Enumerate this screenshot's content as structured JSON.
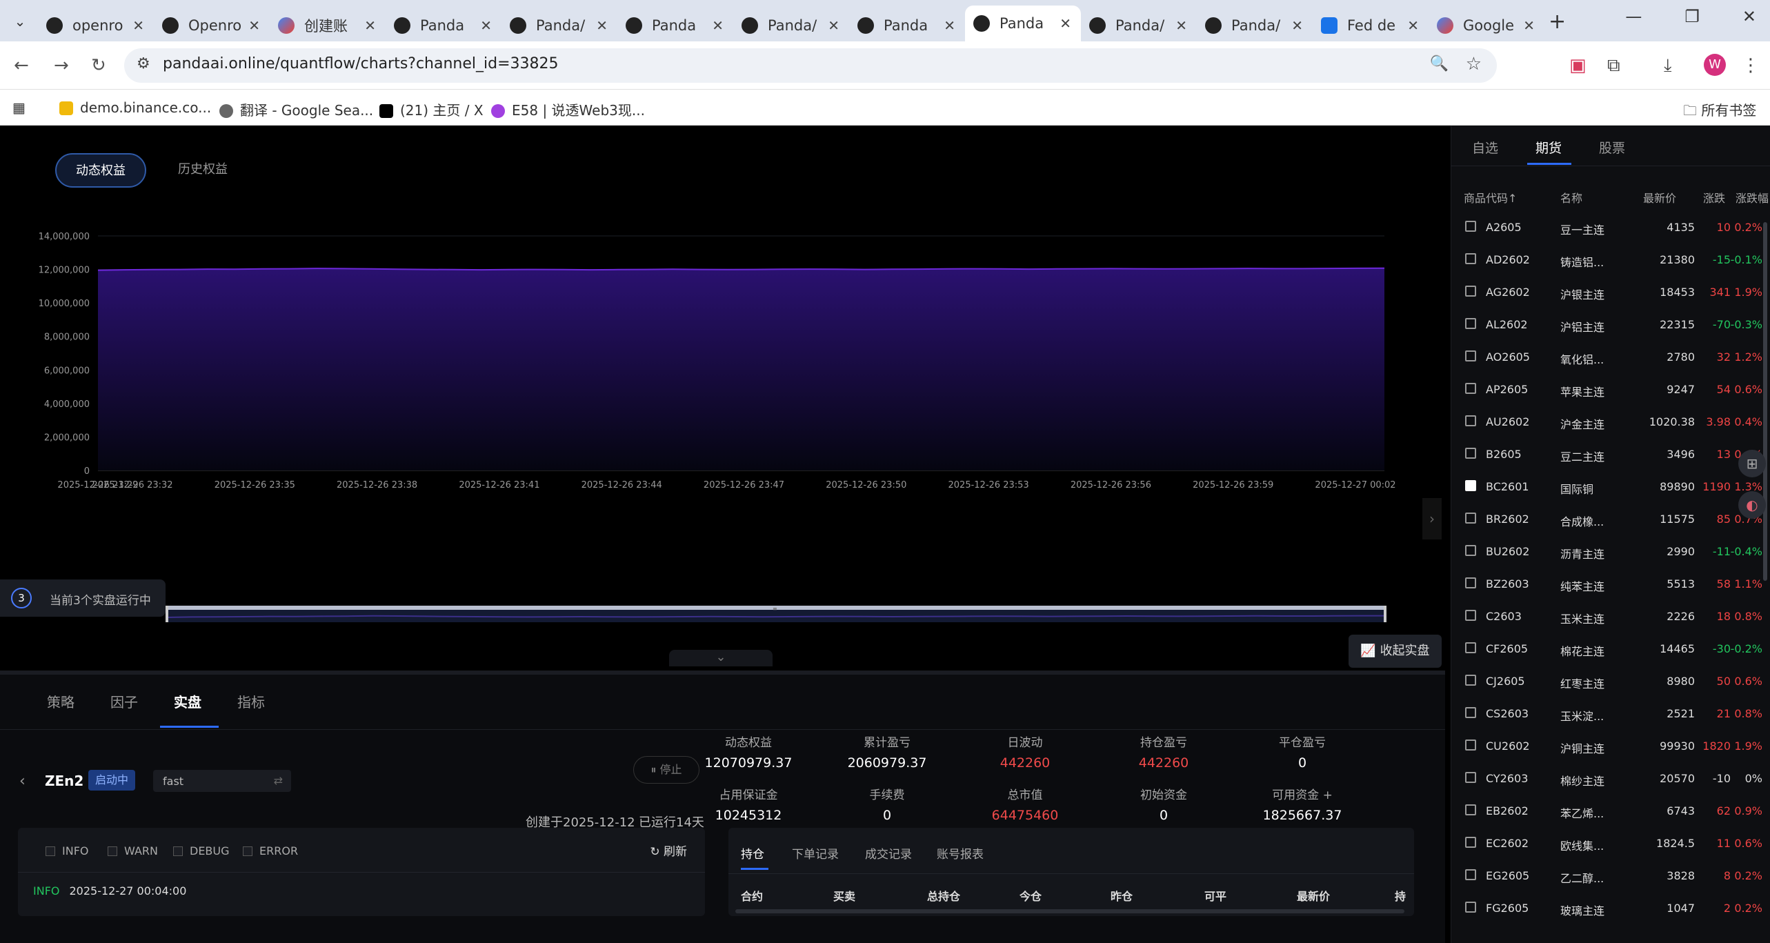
{
  "browser": {
    "tabs": [
      {
        "label": "openro",
        "icon": "openrouter-favicon"
      },
      {
        "label": "Openro",
        "icon": "openrouter-favicon"
      },
      {
        "label": "创建账",
        "icon": "gemini-favicon"
      },
      {
        "label": "Panda",
        "icon": "panda-favicon"
      },
      {
        "label": "Panda/",
        "icon": "panda-favicon"
      },
      {
        "label": "Panda",
        "icon": "panda-favicon"
      },
      {
        "label": "Panda/",
        "icon": "panda-favicon"
      },
      {
        "label": "Panda",
        "icon": "panda-favicon"
      },
      {
        "label": "Panda",
        "icon": "panda-favicon",
        "active": true
      },
      {
        "label": "Panda/",
        "icon": "panda-favicon"
      },
      {
        "label": "Panda/",
        "icon": "panda-favicon"
      },
      {
        "label": "Fed de",
        "icon": "fed-favicon"
      },
      {
        "label": "Google",
        "icon": "gemini-favicon"
      }
    ],
    "url": "pandaai.online/quantflow/charts?channel_id=33825",
    "bookmarks": [
      {
        "label": "demo.binance.co..."
      },
      {
        "label": "翻译 - Google Sea..."
      },
      {
        "label": "(21) 主页 / X"
      },
      {
        "label": "E58 | 说透Web3现..."
      }
    ],
    "all_bookmarks": "所有书签",
    "avatar_letter": "W"
  },
  "chart_view": {
    "toggle_dynamic": "动态权益",
    "toggle_history": "历史权益",
    "runner_badge": "3",
    "runner_text": "当前3个实盘运行中",
    "collapse_button": "收起实盘"
  },
  "chart_data": {
    "type": "area",
    "series": [
      {
        "name": "",
        "values": [
          11950000,
          11980000,
          11990000,
          12000000,
          12020000,
          12010000,
          12030000,
          12040000,
          12060000,
          12050000,
          12030000,
          12010000,
          12000000,
          11990000,
          11980000,
          11990000,
          12000000,
          11990000,
          11980000,
          11990000,
          12000000,
          12010000,
          12000000,
          11990000,
          12000000,
          12010000,
          12020000,
          12010000,
          12000000,
          12010000,
          12020000,
          12030000,
          12040000,
          12030000,
          12020000,
          12030000,
          12040000,
          12050000,
          12040000,
          12030000,
          12040000,
          12050000,
          12060000,
          12050000,
          12050000,
          12060000,
          12070000,
          12070979.37
        ]
      }
    ],
    "x_tick_labels": [
      "2025-12-26 23:29",
      "2025-12-26 23:32",
      "2025-12-26 23:35",
      "2025-12-26 23:38",
      "2025-12-26 23:41",
      "2025-12-26 23:44",
      "2025-12-26 23:47",
      "2025-12-26 23:50",
      "2025-12-26 23:53",
      "2025-12-26 23:56",
      "2025-12-26 23:59",
      "2025-12-27 00:02"
    ],
    "y_ticks": [
      "0",
      "2,000,000",
      "4,000,000",
      "6,000,000",
      "8,000,000",
      "10,000,000",
      "12,000,000",
      "14,000,000"
    ],
    "ylim": [
      0,
      14000000
    ],
    "grid": true,
    "colors": {
      "line": "#6d28d9",
      "area_top": "#2a1170",
      "area_bottom": "#050510"
    }
  },
  "bottom_tabs": [
    "策略",
    "因子",
    "实盘",
    "指标"
  ],
  "strategy": {
    "name": "ZEn2",
    "status": "启动中",
    "mode": "fast",
    "stop_label": "停止",
    "created": "创建于2025-12-12",
    "uptime": "已运行14天"
  },
  "metrics": [
    {
      "label": "动态权益",
      "value": "12070979.37",
      "red": false
    },
    {
      "label": "累计盈亏",
      "value": "2060979.37",
      "red": false
    },
    {
      "label": "日波动",
      "value": "442260",
      "red": true
    },
    {
      "label": "持仓盈亏",
      "value": "442260",
      "red": true
    },
    {
      "label": "平仓盈亏",
      "value": "0",
      "red": false
    },
    {
      "label": "占用保证金",
      "value": "10245312",
      "red": false
    },
    {
      "label": "手续费",
      "value": "0",
      "red": false
    },
    {
      "label": "总市值",
      "value": "64475460",
      "red": true
    },
    {
      "label": "初始资金",
      "value": "0",
      "red": false
    },
    {
      "label": "可用资金 +",
      "value": "1825667.37",
      "red": false
    }
  ],
  "logs": {
    "filters": [
      "INFO",
      "WARN",
      "DEBUG",
      "ERROR"
    ],
    "refresh": "刷新",
    "line_level": "INFO",
    "line_time": "2025-12-27 00:04:00"
  },
  "positions": {
    "tabs": [
      "持仓",
      "下单记录",
      "成交记录",
      "账号报表"
    ],
    "columns": [
      "合约",
      "买卖",
      "总持仓",
      "今仓",
      "昨仓",
      "可平",
      "最新价",
      "持"
    ]
  },
  "market": {
    "tabs": [
      "自选",
      "期货",
      "股票"
    ],
    "headers": [
      "商品代码↑",
      "名称",
      "最新价",
      "涨跌",
      "涨跌幅"
    ],
    "rows": [
      {
        "code": "A2605",
        "name": "豆一主连",
        "price": "4135",
        "chg": "10",
        "pct": "0.2%",
        "dir": "up"
      },
      {
        "code": "AD2602",
        "name": "铸造铝...",
        "price": "21380",
        "chg": "-15",
        "pct": "-0.1%",
        "dir": "dn"
      },
      {
        "code": "AG2602",
        "name": "沪银主连",
        "price": "18453",
        "chg": "341",
        "pct": "1.9%",
        "dir": "up"
      },
      {
        "code": "AL2602",
        "name": "沪铝主连",
        "price": "22315",
        "chg": "-70",
        "pct": "-0.3%",
        "dir": "dn"
      },
      {
        "code": "AO2605",
        "name": "氧化铝...",
        "price": "2780",
        "chg": "32",
        "pct": "1.2%",
        "dir": "up"
      },
      {
        "code": "AP2605",
        "name": "苹果主连",
        "price": "9247",
        "chg": "54",
        "pct": "0.6%",
        "dir": "up"
      },
      {
        "code": "AU2602",
        "name": "沪金主连",
        "price": "1020.38",
        "chg": "3.98",
        "pct": "0.4%",
        "dir": "up"
      },
      {
        "code": "B2605",
        "name": "豆二主连",
        "price": "3496",
        "chg": "13",
        "pct": "0.4%",
        "dir": "up"
      },
      {
        "code": "BC2601",
        "name": "国际铜",
        "price": "89890",
        "chg": "1190",
        "pct": "1.3%",
        "dir": "up",
        "fav": true
      },
      {
        "code": "BR2602",
        "name": "合成橡...",
        "price": "11575",
        "chg": "85",
        "pct": "0.7%",
        "dir": "up"
      },
      {
        "code": "BU2602",
        "name": "沥青主连",
        "price": "2990",
        "chg": "-11",
        "pct": "-0.4%",
        "dir": "dn"
      },
      {
        "code": "BZ2603",
        "name": "纯苯主连",
        "price": "5513",
        "chg": "58",
        "pct": "1.1%",
        "dir": "up"
      },
      {
        "code": "C2603",
        "name": "玉米主连",
        "price": "2226",
        "chg": "18",
        "pct": "0.8%",
        "dir": "up"
      },
      {
        "code": "CF2605",
        "name": "棉花主连",
        "price": "14465",
        "chg": "-30",
        "pct": "-0.2%",
        "dir": "dn"
      },
      {
        "code": "CJ2605",
        "name": "红枣主连",
        "price": "8980",
        "chg": "50",
        "pct": "0.6%",
        "dir": "up"
      },
      {
        "code": "CS2603",
        "name": "玉米淀...",
        "price": "2521",
        "chg": "21",
        "pct": "0.8%",
        "dir": "up"
      },
      {
        "code": "CU2602",
        "name": "沪铜主连",
        "price": "99930",
        "chg": "1820",
        "pct": "1.9%",
        "dir": "up"
      },
      {
        "code": "CY2603",
        "name": "棉纱主连",
        "price": "20570",
        "chg": "-10",
        "pct": "0%",
        "dir": "zero"
      },
      {
        "code": "EB2602",
        "name": "苯乙烯...",
        "price": "6743",
        "chg": "62",
        "pct": "0.9%",
        "dir": "up"
      },
      {
        "code": "EC2602",
        "name": "欧线集...",
        "price": "1824.5",
        "chg": "11",
        "pct": "0.6%",
        "dir": "up"
      },
      {
        "code": "EG2605",
        "name": "乙二醇...",
        "price": "3828",
        "chg": "8",
        "pct": "0.2%",
        "dir": "up"
      },
      {
        "code": "FG2605",
        "name": "玻璃主连",
        "price": "1047",
        "chg": "2",
        "pct": "0.2%",
        "dir": "up"
      }
    ]
  }
}
